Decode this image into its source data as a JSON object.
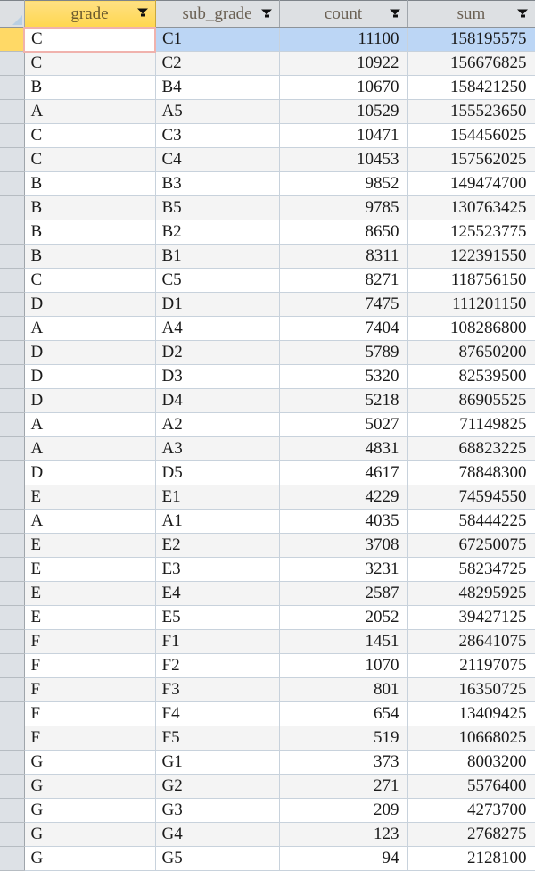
{
  "app": {
    "type": "spreadsheet",
    "colors": {
      "header_bg": "#dde0e3",
      "header_text": "#6b6154",
      "header_highlight_bg": "#ffd74f",
      "rownum_bg": "#dde1e6",
      "rownum_active_bg": "#ffd966",
      "row_alt_bg": "#f4f4f4",
      "selection_bg": "#bcd6f5",
      "active_cell_border": "#f0b2ad",
      "gridline": "#c8d2dc"
    }
  },
  "corner": {
    "name": "select-all-corner"
  },
  "columns": [
    {
      "key": "grade",
      "label": "grade",
      "align": "left",
      "filter": true,
      "highlighted": true
    },
    {
      "key": "sub_grade",
      "label": "sub_grade",
      "align": "left",
      "filter": true,
      "highlighted": false
    },
    {
      "key": "count",
      "label": "count",
      "align": "right",
      "filter": true,
      "highlighted": false
    },
    {
      "key": "sum",
      "label": "sum",
      "align": "right",
      "filter": true,
      "highlighted": false
    }
  ],
  "selection": {
    "active_cell": {
      "row": 0,
      "column": "grade",
      "value": "C"
    },
    "selected_row_index": 0
  },
  "rows": [
    {
      "grade": "C",
      "sub_grade": "C1",
      "count": "11100",
      "sum": "158195575"
    },
    {
      "grade": "C",
      "sub_grade": "C2",
      "count": "10922",
      "sum": "156676825"
    },
    {
      "grade": "B",
      "sub_grade": "B4",
      "count": "10670",
      "sum": "158421250"
    },
    {
      "grade": "A",
      "sub_grade": "A5",
      "count": "10529",
      "sum": "155523650"
    },
    {
      "grade": "C",
      "sub_grade": "C3",
      "count": "10471",
      "sum": "154456025"
    },
    {
      "grade": "C",
      "sub_grade": "C4",
      "count": "10453",
      "sum": "157562025"
    },
    {
      "grade": "B",
      "sub_grade": "B3",
      "count": "9852",
      "sum": "149474700"
    },
    {
      "grade": "B",
      "sub_grade": "B5",
      "count": "9785",
      "sum": "130763425"
    },
    {
      "grade": "B",
      "sub_grade": "B2",
      "count": "8650",
      "sum": "125523775"
    },
    {
      "grade": "B",
      "sub_grade": "B1",
      "count": "8311",
      "sum": "122391550"
    },
    {
      "grade": "C",
      "sub_grade": "C5",
      "count": "8271",
      "sum": "118756150"
    },
    {
      "grade": "D",
      "sub_grade": "D1",
      "count": "7475",
      "sum": "111201150"
    },
    {
      "grade": "A",
      "sub_grade": "A4",
      "count": "7404",
      "sum": "108286800"
    },
    {
      "grade": "D",
      "sub_grade": "D2",
      "count": "5789",
      "sum": "87650200"
    },
    {
      "grade": "D",
      "sub_grade": "D3",
      "count": "5320",
      "sum": "82539500"
    },
    {
      "grade": "D",
      "sub_grade": "D4",
      "count": "5218",
      "sum": "86905525"
    },
    {
      "grade": "A",
      "sub_grade": "A2",
      "count": "5027",
      "sum": "71149825"
    },
    {
      "grade": "A",
      "sub_grade": "A3",
      "count": "4831",
      "sum": "68823225"
    },
    {
      "grade": "D",
      "sub_grade": "D5",
      "count": "4617",
      "sum": "78848300"
    },
    {
      "grade": "E",
      "sub_grade": "E1",
      "count": "4229",
      "sum": "74594550"
    },
    {
      "grade": "A",
      "sub_grade": "A1",
      "count": "4035",
      "sum": "58444225"
    },
    {
      "grade": "E",
      "sub_grade": "E2",
      "count": "3708",
      "sum": "67250075"
    },
    {
      "grade": "E",
      "sub_grade": "E3",
      "count": "3231",
      "sum": "58234725"
    },
    {
      "grade": "E",
      "sub_grade": "E4",
      "count": "2587",
      "sum": "48295925"
    },
    {
      "grade": "E",
      "sub_grade": "E5",
      "count": "2052",
      "sum": "39427125"
    },
    {
      "grade": "F",
      "sub_grade": "F1",
      "count": "1451",
      "sum": "28641075"
    },
    {
      "grade": "F",
      "sub_grade": "F2",
      "count": "1070",
      "sum": "21197075"
    },
    {
      "grade": "F",
      "sub_grade": "F3",
      "count": "801",
      "sum": "16350725"
    },
    {
      "grade": "F",
      "sub_grade": "F4",
      "count": "654",
      "sum": "13409425"
    },
    {
      "grade": "F",
      "sub_grade": "F5",
      "count": "519",
      "sum": "10668025"
    },
    {
      "grade": "G",
      "sub_grade": "G1",
      "count": "373",
      "sum": "8003200"
    },
    {
      "grade": "G",
      "sub_grade": "G2",
      "count": "271",
      "sum": "5576400"
    },
    {
      "grade": "G",
      "sub_grade": "G3",
      "count": "209",
      "sum": "4273700"
    },
    {
      "grade": "G",
      "sub_grade": "G4",
      "count": "123",
      "sum": "2768275"
    },
    {
      "grade": "G",
      "sub_grade": "G5",
      "count": "94",
      "sum": "2128100"
    }
  ]
}
